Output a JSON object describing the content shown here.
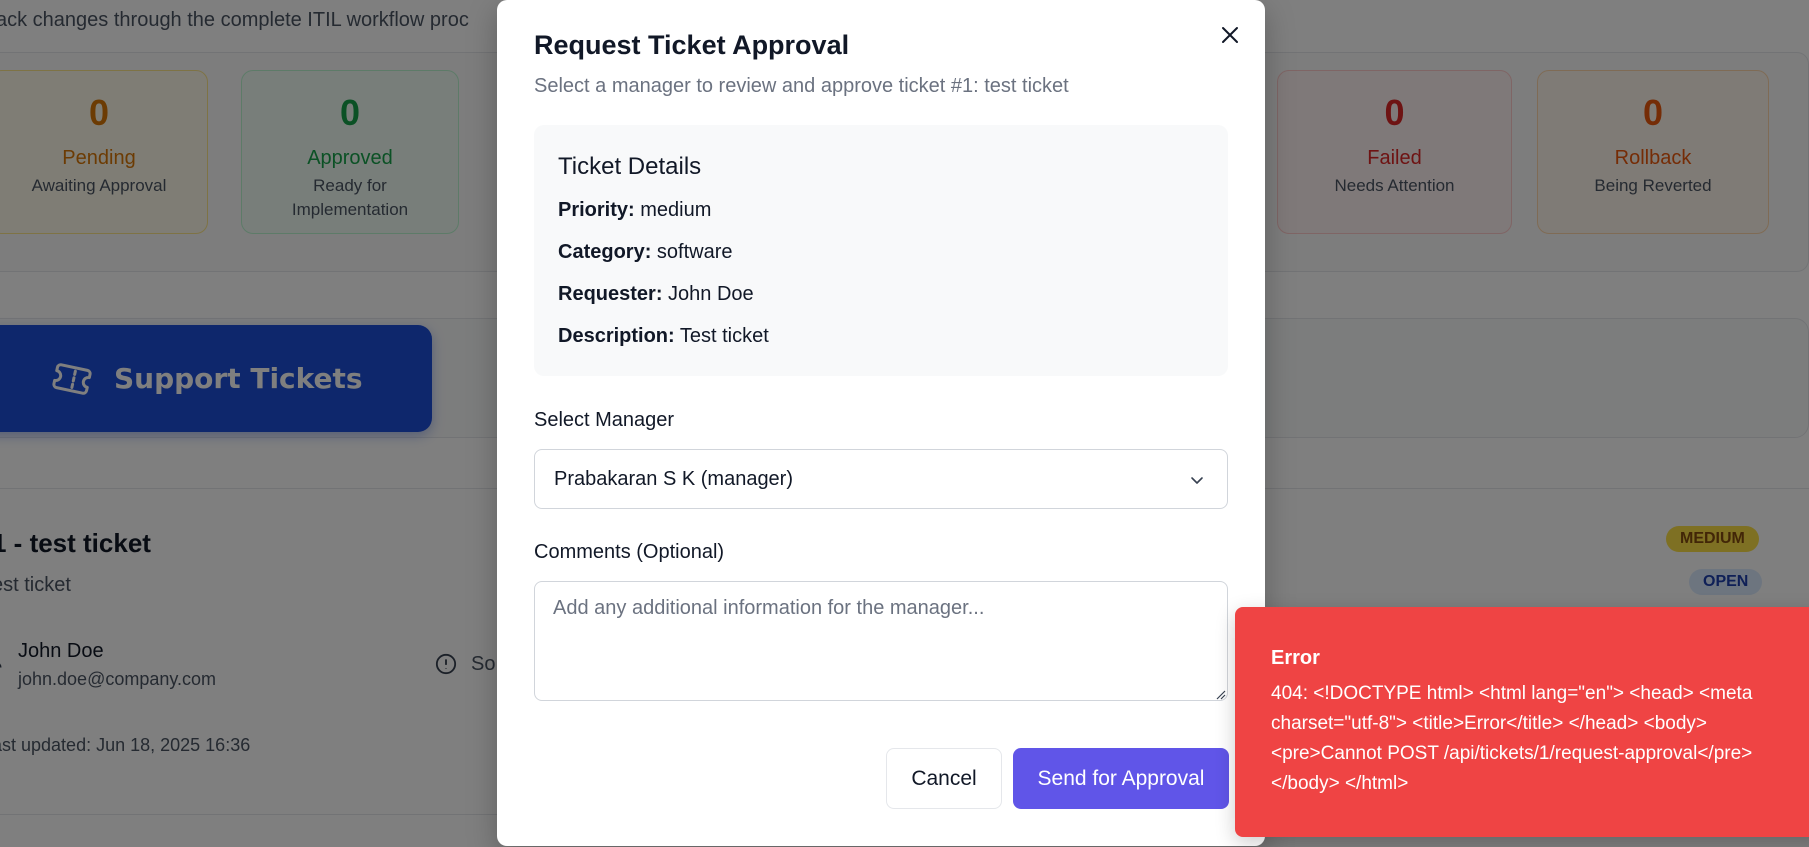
{
  "page": {
    "subtitle": "ack changes through the complete ITIL workflow proc"
  },
  "stats": [
    {
      "value": "0",
      "label": "Pending",
      "desc": "Awaiting Approval"
    },
    {
      "value": "0",
      "label": "Approved",
      "desc": "Ready for Implementation"
    },
    {
      "value": "0",
      "label": "Failed",
      "desc": "Needs Attention"
    },
    {
      "value": "0",
      "label": "Rollback",
      "desc": "Being Reverted"
    }
  ],
  "tabs": {
    "active_label": "Support Tickets",
    "active_icon": "ticket-icon"
  },
  "ticket": {
    "title": "1 - test ticket",
    "description": "est ticket",
    "requester_name": "John Doe",
    "requester_email": "john.doe@company.com",
    "category_short": "So",
    "last_updated": "ast updated: Jun 18, 2025 16:36",
    "priority_badge": "MEDIUM",
    "status_badge": "OPEN"
  },
  "modal": {
    "title": "Request Ticket Approval",
    "subtitle": "Select a manager to review and approve ticket #1: test ticket",
    "close_icon": "close-icon",
    "details": {
      "heading": "Ticket Details",
      "priority_label": "Priority:",
      "priority_value": "medium",
      "category_label": "Category:",
      "category_value": "software",
      "requester_label": "Requester:",
      "requester_value": "John Doe",
      "description_label": "Description:",
      "description_value": "Test ticket"
    },
    "manager_label": "Select Manager",
    "manager_selected": "Prabakaran S K (manager)",
    "comments_label": "Comments (Optional)",
    "comments_placeholder": "Add any additional information for the manager...",
    "cancel_label": "Cancel",
    "submit_label": "Send for Approval"
  },
  "toast": {
    "title": "Error",
    "message": "404: <!DOCTYPE html> <html lang=\"en\"> <head> <meta charset=\"utf-8\"> <title>Error</title> </head> <body> <pre>Cannot POST /api/tickets/1/request-approval</pre> </body> </html>"
  },
  "colors": {
    "primary": "#6055e8",
    "error": "#ef4444",
    "tab_active": "#1d4ed8",
    "pending": "#d97706",
    "approved": "#16a34a",
    "failed": "#dc2626",
    "rollback": "#ea580c"
  }
}
